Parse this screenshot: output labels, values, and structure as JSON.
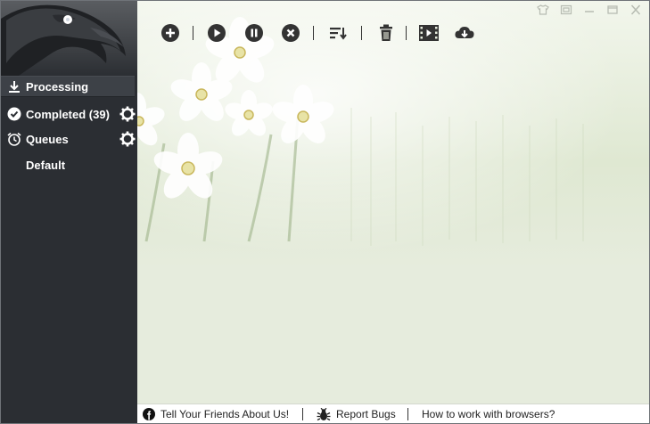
{
  "sidebar": {
    "items": [
      {
        "label": "Processing",
        "icon": "download-icon",
        "active": true
      },
      {
        "label": "Completed (39)",
        "icon": "check-circle-icon",
        "has_settings": true
      },
      {
        "label": "Queues",
        "icon": "alarm-clock-icon",
        "has_settings": true
      },
      {
        "label": "Default"
      }
    ]
  },
  "toolbar": {
    "buttons": [
      "add-icon",
      "play-icon",
      "pause-icon",
      "stop-icon",
      "sort-icon",
      "trash-icon",
      "film-icon",
      "cloud-download-icon"
    ]
  },
  "window_controls": [
    "skin-icon",
    "mini-mode-icon",
    "minimize-icon",
    "maximize-icon",
    "close-icon"
  ],
  "footer": {
    "tell_friends": "Tell Your Friends About Us!",
    "report_bugs": "Report Bugs",
    "browsers_help": "How to work with browsers?"
  },
  "colors": {
    "sidebar_bg": "#2b2e33",
    "main_bg": "#e6ecdd",
    "accent_white": "#ffffff"
  }
}
